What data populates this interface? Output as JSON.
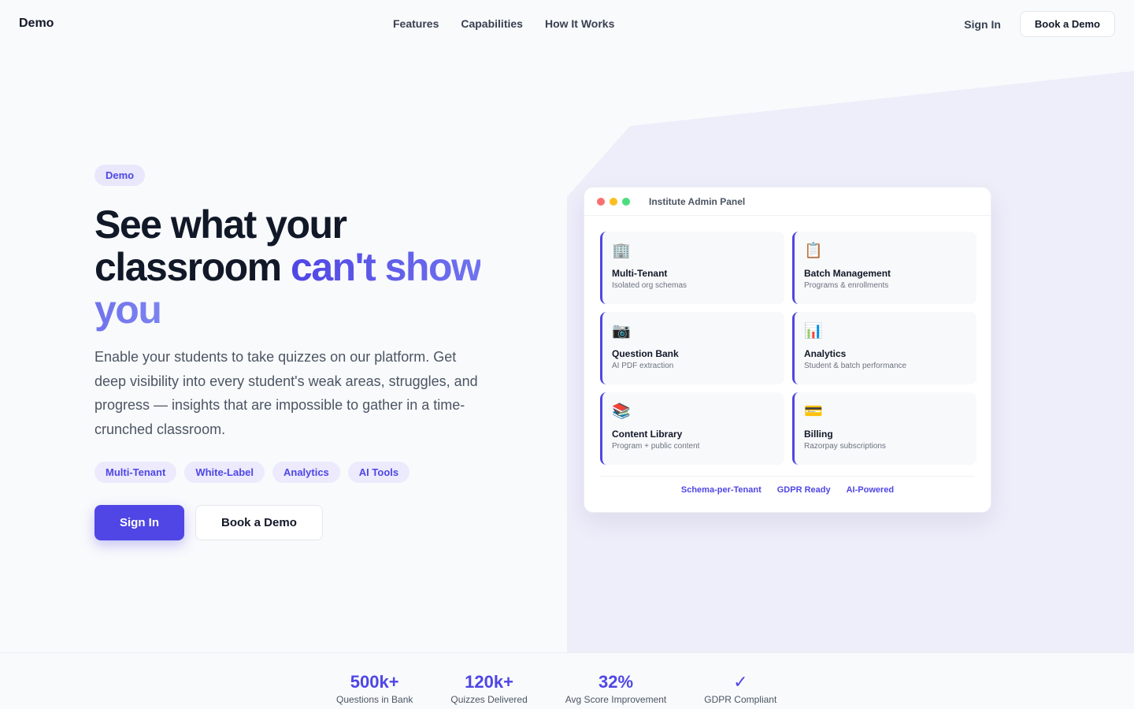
{
  "nav": {
    "brand": "Demo",
    "links": [
      "Features",
      "Capabilities",
      "How It Works"
    ],
    "sign_in": "Sign In",
    "book_demo": "Book a Demo"
  },
  "hero": {
    "pill": "Demo",
    "headline_part1": "See what your classroom ",
    "headline_accent": "can't show you",
    "description": "Enable your students to take quizzes on our platform. Get deep visibility into every student's weak areas, struggles, and progress — insights that are impossible to gather in a time-crunched classroom.",
    "tags": [
      "Multi-Tenant",
      "White-Label",
      "Analytics",
      "AI Tools"
    ],
    "primary_cta": "Sign In",
    "secondary_cta": "Book a Demo"
  },
  "panel": {
    "title": "Institute Admin Panel",
    "cards": [
      {
        "icon": "🏢",
        "title": "Multi-Tenant",
        "sub": "Isolated org schemas"
      },
      {
        "icon": "📋",
        "title": "Batch Management",
        "sub": "Programs & enrollments"
      },
      {
        "icon": "📷",
        "title": "Question Bank",
        "sub": "AI PDF extraction"
      },
      {
        "icon": "📊",
        "title": "Analytics",
        "sub": "Student & batch performance"
      },
      {
        "icon": "📚",
        "title": "Content Library",
        "sub": "Program + public content"
      },
      {
        "icon": "💳",
        "title": "Billing",
        "sub": "Razorpay subscriptions"
      }
    ],
    "footer": [
      "Schema-per-Tenant",
      "GDPR Ready",
      "AI-Powered"
    ]
  },
  "stats": [
    {
      "value": "500k+",
      "label": "Questions in Bank"
    },
    {
      "value": "120k+",
      "label": "Quizzes Delivered"
    },
    {
      "value": "32%",
      "label": "Avg Score Improvement"
    },
    {
      "value": "✓",
      "label": "GDPR Compliant"
    }
  ],
  "colors": {
    "accent": "#4f46e5",
    "dot_red": "#f87171",
    "dot_yellow": "#fbbf24",
    "dot_green": "#4ade80"
  }
}
